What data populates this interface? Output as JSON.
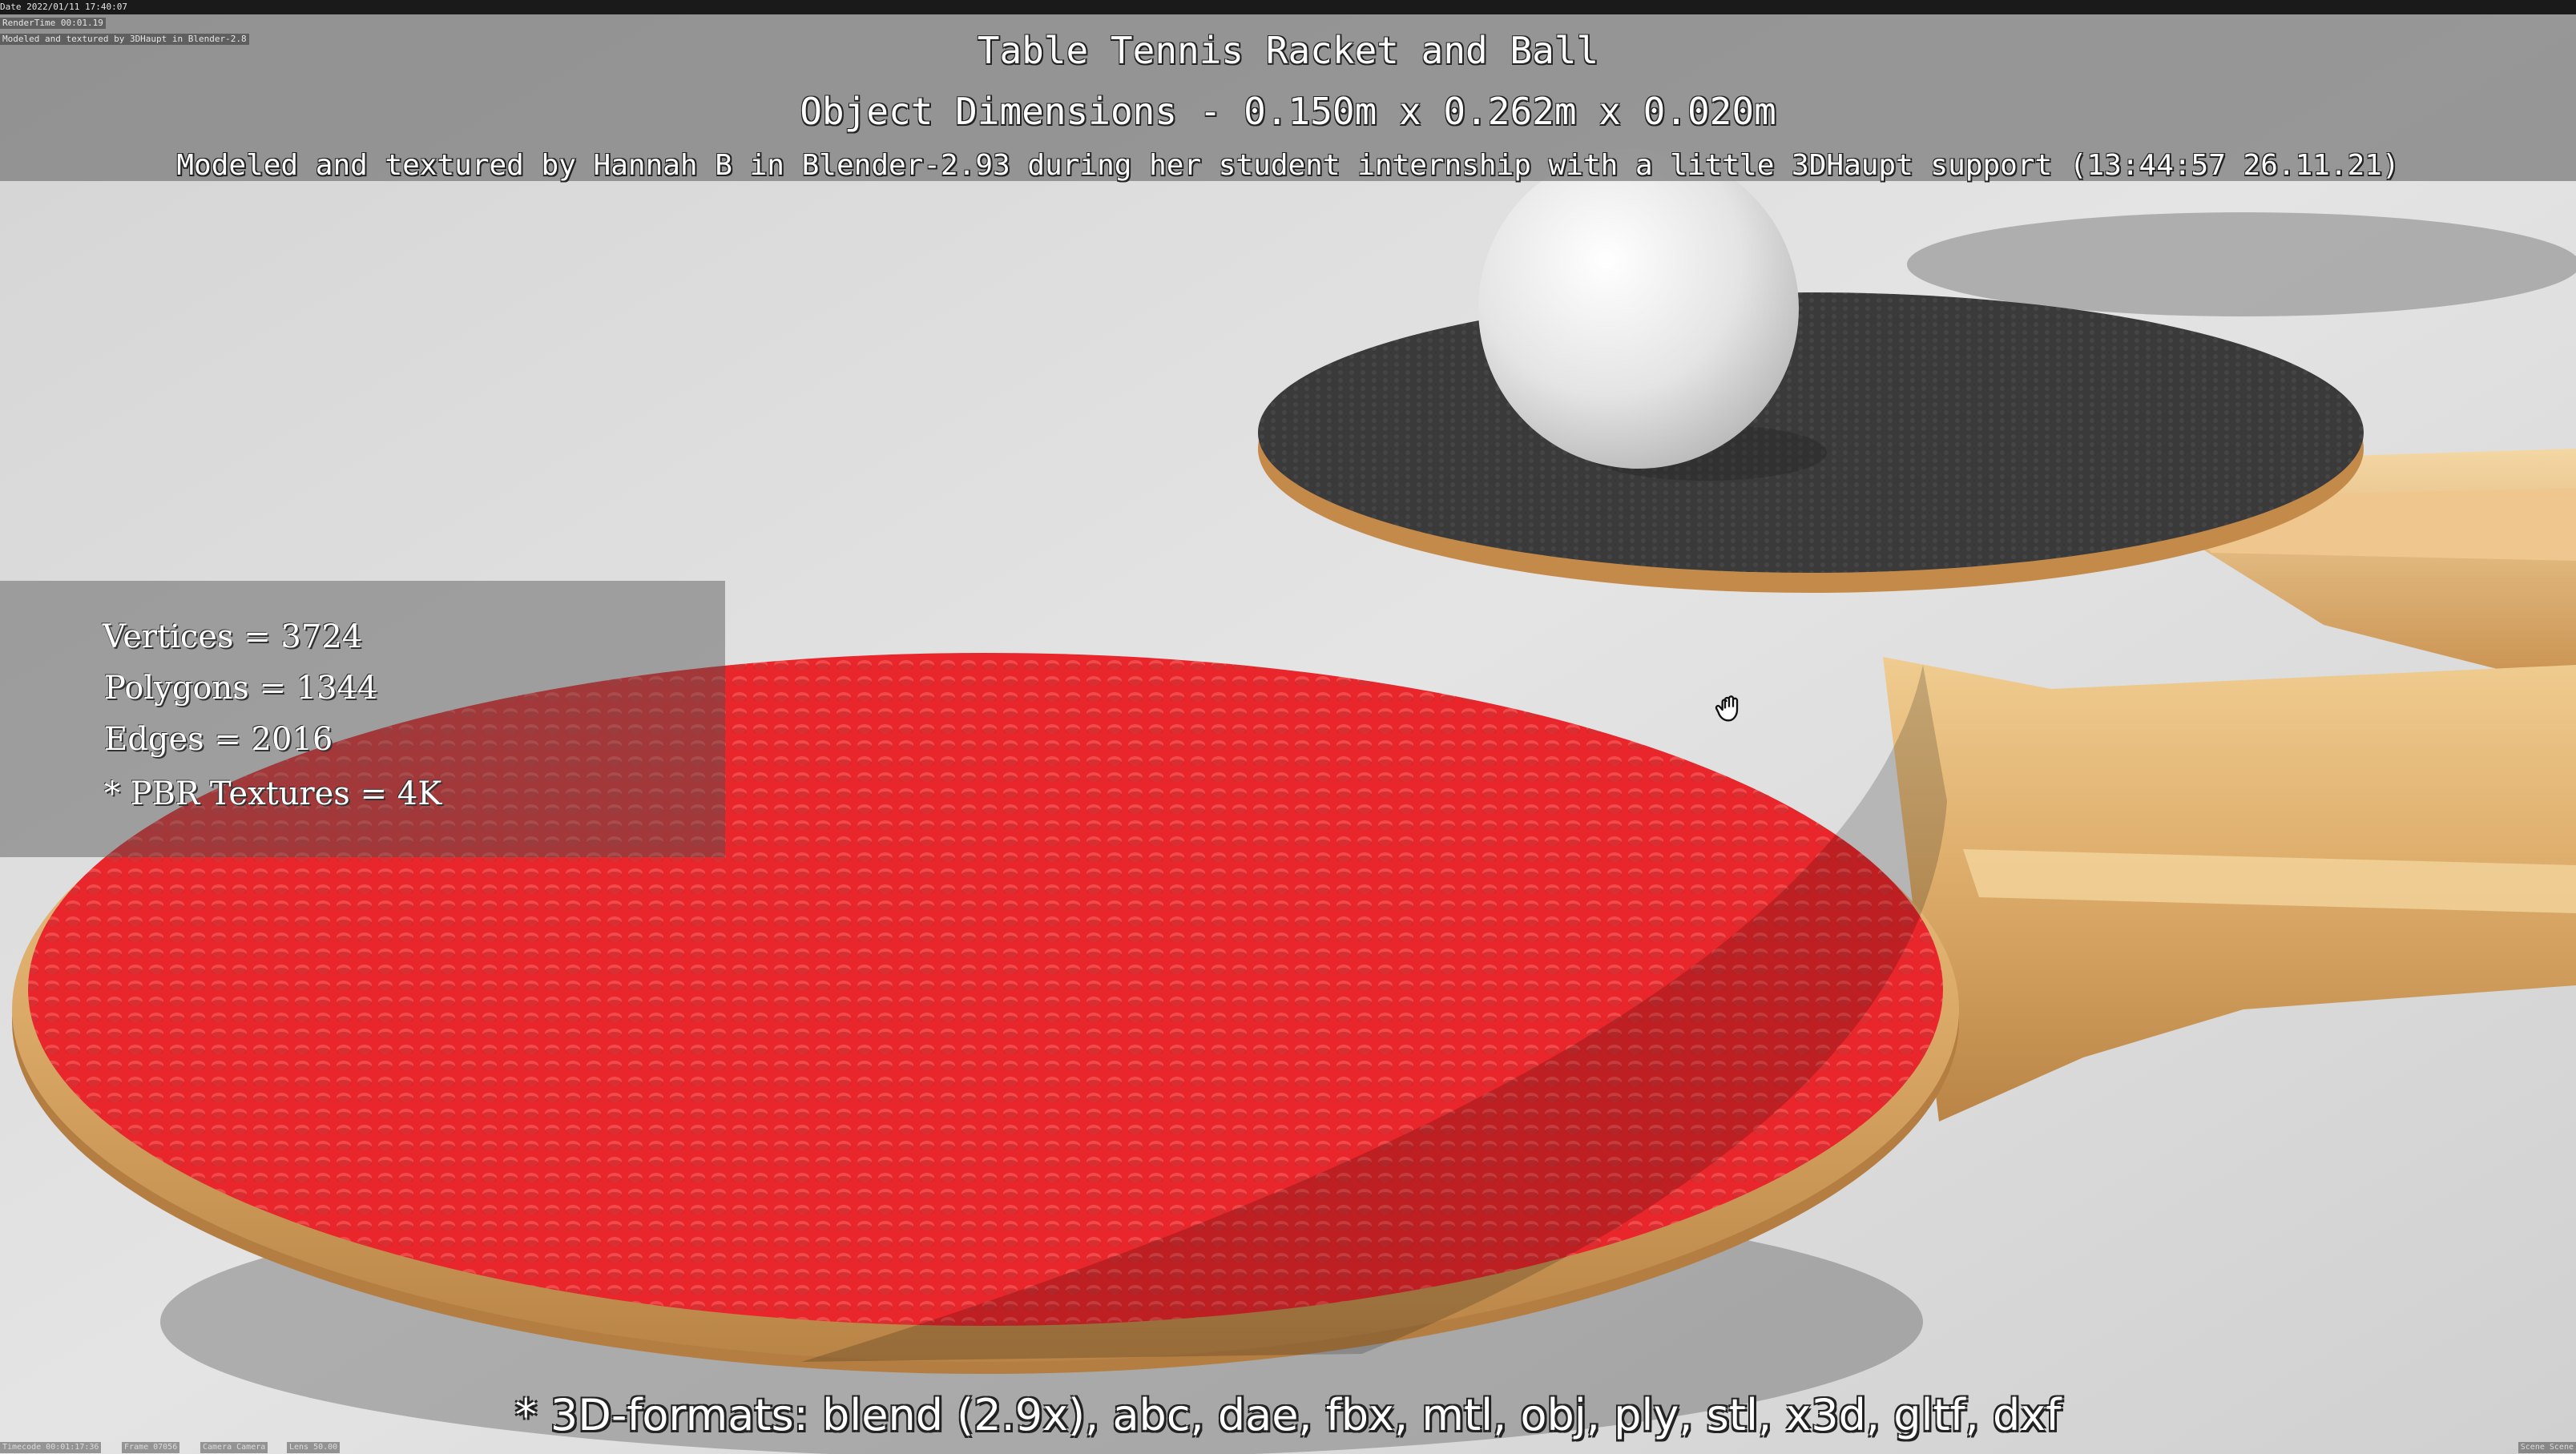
{
  "overlay_stamps": {
    "date": "Date 2022/01/11 17:40:07",
    "render_time": "RenderTime 00:01.19",
    "note": "Modeled and textured by 3DHaupt in Blender-2.8"
  },
  "header": {
    "title": "Table Tennis Racket and Ball",
    "dimensions": "Object Dimensions -  0.150m x 0.262m x 0.020m",
    "credit": "Modeled and textured by Hannah B in Blender-2.93 during her student internship with a little 3DHaupt support (13:44:57 26.11.21)"
  },
  "stats": {
    "vertices": "Vertices = 3724",
    "polygons": "Polygons = 1344",
    "edges": "Edges = 2016",
    "textures": "* PBR Textures = 4K"
  },
  "formats": "* 3D-formats: blend (2.9x), abc, dae, fbx, mtl, obj, ply, stl, x3d, gltf, dxf",
  "footer": {
    "timecode": "Timecode 00:01:17:36",
    "frame": "Frame 07056",
    "camera": "Camera Camera",
    "lens": "Lens 50.00",
    "scene": "Scene Scene"
  },
  "colors": {
    "rubber_red": "#e8262b",
    "rubber_black": "#3a3a3a",
    "wood": "#e2b272",
    "background": "#d8d8d8",
    "ball": "#f2f2f2"
  }
}
